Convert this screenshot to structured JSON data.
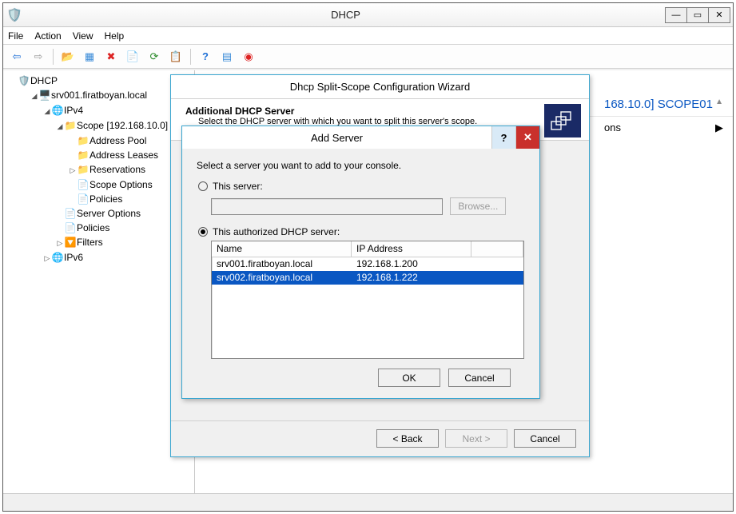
{
  "main_window": {
    "title": "DHCP",
    "menu": [
      "File",
      "Action",
      "View",
      "Help"
    ]
  },
  "tree": {
    "root": "DHCP",
    "server": "srv001.firatboyan.local",
    "ipv4": "IPv4",
    "scope": "Scope [192.168.10.0] SCOPE01",
    "scope_children": [
      "Address Pool",
      "Address Leases",
      "Reservations",
      "Scope Options",
      "Policies"
    ],
    "ipv4_tail": [
      "Server Options",
      "Policies",
      "Filters"
    ],
    "ipv6": "IPv6"
  },
  "detail": {
    "header_partial": "168.10.0] SCOPE01",
    "row_label_partial": "ons"
  },
  "wizard": {
    "title": "Dhcp Split-Scope Configuration Wizard",
    "heading": "Additional DHCP Server",
    "subheading": "Select the DHCP server with which you want to split this server's scope.",
    "buttons": {
      "back": "< Back",
      "next": "Next >",
      "cancel": "Cancel"
    }
  },
  "add_server": {
    "title": "Add Server",
    "prompt": "Select a server you want to add to your console.",
    "opt_this": "This server:",
    "opt_auth": "This authorized DHCP server:",
    "browse": "Browse...",
    "columns": {
      "name": "Name",
      "ip": "IP Address"
    },
    "rows": [
      {
        "name": "srv001.firatboyan.local",
        "ip": "192.168.1.200",
        "selected": false
      },
      {
        "name": "srv002.firatboyan.local",
        "ip": "192.168.1.222",
        "selected": true
      }
    ],
    "ok": "OK",
    "cancel": "Cancel"
  }
}
